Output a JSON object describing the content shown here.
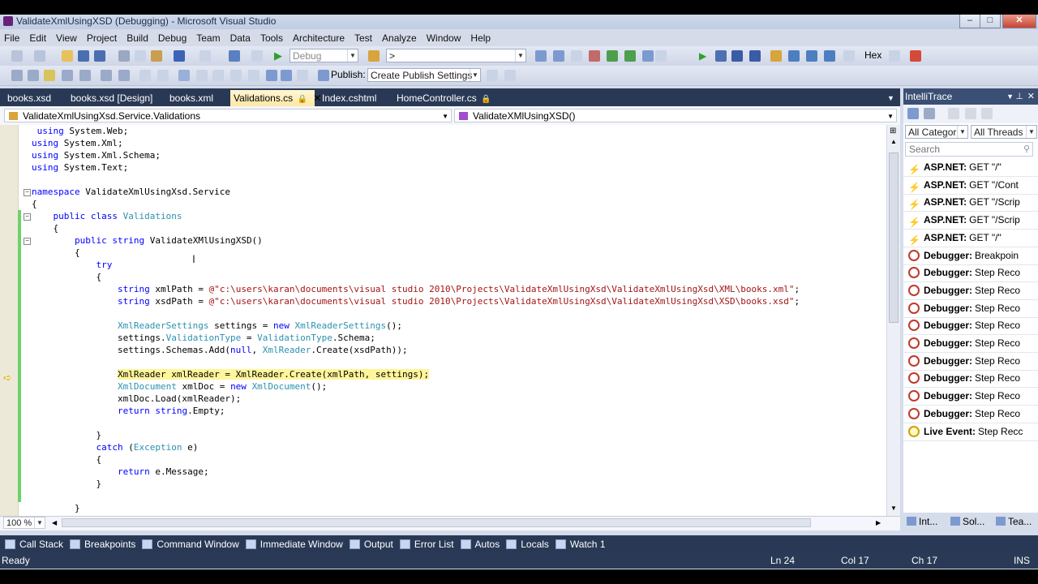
{
  "window": {
    "title": "ValidateXmlUsingXSD (Debugging) - Microsoft Visual Studio",
    "minimize": "–",
    "maximize": "□",
    "close": "✕"
  },
  "menu": [
    "File",
    "Edit",
    "View",
    "Project",
    "Build",
    "Debug",
    "Team",
    "Data",
    "Tools",
    "Architecture",
    "Test",
    "Analyze",
    "Window",
    "Help"
  ],
  "toolbar": {
    "config": "Debug",
    "find": ">",
    "hex": "Hex",
    "publish_label": "Publish:",
    "publish_value": "Create Publish Settings"
  },
  "tabs": [
    {
      "label": "books.xsd"
    },
    {
      "label": "books.xsd [Design]"
    },
    {
      "label": "books.xml"
    },
    {
      "label": "Validations.cs"
    },
    {
      "label": "Index.cshtml"
    },
    {
      "label": "HomeController.cs"
    }
  ],
  "navbar": {
    "left": "ValidateXmlUsingXsd.Service.Validations",
    "right": "ValidateXMlUsingXSD()"
  },
  "code": [
    "using System.Web;",
    "using System.Xml;",
    "using System.Xml.Schema;",
    "using System.Text;",
    "",
    "namespace ValidateXmlUsingXsd.Service",
    "{",
    "    public class Validations",
    "    {",
    "        public string ValidateXMlUsingXSD()",
    "        {",
    "            try",
    "            {",
    "                string xmlPath = @\"c:\\users\\karan\\documents\\visual studio 2010\\Projects\\ValidateXmlUsingXsd\\ValidateXmlUsingXsd\\XML\\books.xml\";",
    "                string xsdPath = @\"c:\\users\\karan\\documents\\visual studio 2010\\Projects\\ValidateXmlUsingXsd\\ValidateXmlUsingXsd\\XSD\\books.xsd\";",
    "",
    "                XmlReaderSettings settings = new XmlReaderSettings();",
    "                settings.ValidationType = ValidationType.Schema;",
    "                settings.Schemas.Add(null, XmlReader.Create(xsdPath));",
    "",
    "                XmlReader xmlReader = XmlReader.Create(xmlPath, settings);",
    "                XmlDocument xmlDoc = new XmlDocument();",
    "                xmlDoc.Load(xmlReader);",
    "                return string.Empty;",
    "",
    "            }",
    "            catch (Exception e)",
    "            {",
    "                return e.Message;",
    "            }",
    "",
    "        }"
  ],
  "zoom": "100 %",
  "intellitrace": {
    "title": "IntelliTrace",
    "filter_category": "All Categor",
    "filter_threads": "All Threads",
    "search_placeholder": "Search",
    "events": [
      {
        "kind": "ASP.NET:",
        "text": "GET \"/\"",
        "icon": "lightning-icon"
      },
      {
        "kind": "ASP.NET:",
        "text": "GET \"/Cont",
        "icon": "lightning-icon"
      },
      {
        "kind": "ASP.NET:",
        "text": "GET \"/Scrip",
        "icon": "lightning-icon"
      },
      {
        "kind": "ASP.NET:",
        "text": "GET \"/Scrip",
        "icon": "lightning-icon"
      },
      {
        "kind": "ASP.NET:",
        "text": "GET \"/\"",
        "icon": "lightning-icon"
      },
      {
        "kind": "Debugger:",
        "text": "Breakpoin",
        "icon": "debugger-stop-icon"
      },
      {
        "kind": "Debugger:",
        "text": "Step Reco",
        "icon": "debugger-stop-icon"
      },
      {
        "kind": "Debugger:",
        "text": "Step Reco",
        "icon": "debugger-stop-icon"
      },
      {
        "kind": "Debugger:",
        "text": "Step Reco",
        "icon": "debugger-stop-icon"
      },
      {
        "kind": "Debugger:",
        "text": "Step Reco",
        "icon": "debugger-stop-icon"
      },
      {
        "kind": "Debugger:",
        "text": "Step Reco",
        "icon": "debugger-stop-icon"
      },
      {
        "kind": "Debugger:",
        "text": "Step Reco",
        "icon": "debugger-stop-icon"
      },
      {
        "kind": "Debugger:",
        "text": "Step Reco",
        "icon": "debugger-stop-icon"
      },
      {
        "kind": "Debugger:",
        "text": "Step Reco",
        "icon": "debugger-stop-icon"
      },
      {
        "kind": "Debugger:",
        "text": "Step Reco",
        "icon": "debugger-stop-icon"
      },
      {
        "kind": "Live Event:",
        "text": "Step Recc",
        "icon": "live-event-icon"
      }
    ],
    "bottom_tabs": [
      "Int...",
      "Sol...",
      "Tea..."
    ]
  },
  "toolwindows": [
    "Call Stack",
    "Breakpoints",
    "Command Window",
    "Immediate Window",
    "Output",
    "Error List",
    "Autos",
    "Locals",
    "Watch 1"
  ],
  "status": {
    "ready": "Ready",
    "ln": "Ln 24",
    "col": "Col 17",
    "ch": "Ch 17",
    "ins": "INS"
  },
  "colors": {
    "chrome_dark": "#293955",
    "active_tab": "#ffe8a6",
    "current_line": "#fff59a",
    "keyword": "#0000ff",
    "type": "#2b91af",
    "string": "#a31515"
  }
}
